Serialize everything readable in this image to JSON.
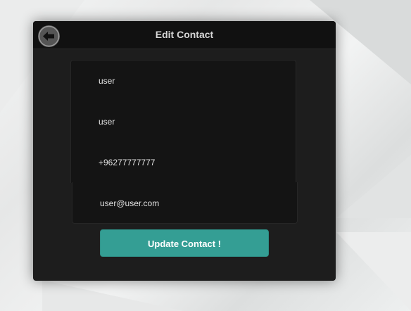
{
  "dialog": {
    "title": "Edit Contact",
    "back_icon": "arrow-left-icon",
    "fields": {
      "first_name": "user",
      "last_name": "user",
      "phone": "+96277777777",
      "email": "user@user.com"
    },
    "update_label": "Update Contact !"
  },
  "colors": {
    "dialog_bg": "#1d1d1d",
    "header_bg": "#111111",
    "field_bg": "#141414",
    "accent": "#349e94"
  }
}
